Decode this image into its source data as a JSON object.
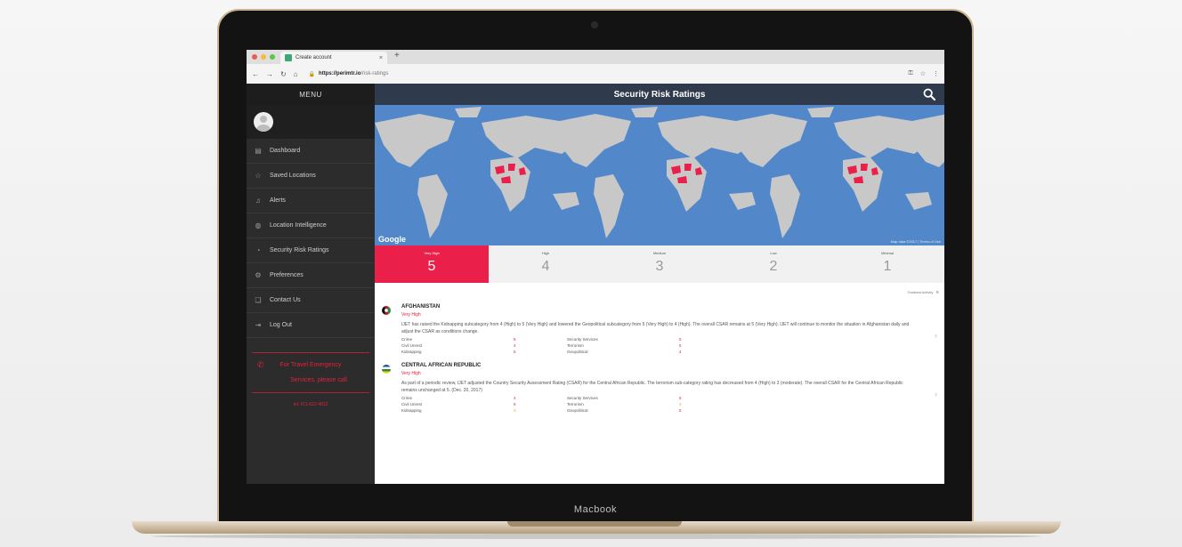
{
  "browser": {
    "tab_title": "Create account",
    "url_host": "https://perimtr.io",
    "url_path": "/risk-ratings",
    "new_tab": "+",
    "close": "×"
  },
  "device": {
    "label": "Macbook"
  },
  "sidebar": {
    "menu_title": "MENU",
    "items": [
      {
        "label": "Dashboard",
        "icon": "grid-icon"
      },
      {
        "label": "Saved Locations",
        "icon": "star-icon"
      },
      {
        "label": "Alerts",
        "icon": "bell-icon"
      },
      {
        "label": "Location Intelligence",
        "icon": "globe-icon"
      },
      {
        "label": "Security Risk Ratings",
        "icon": "gauge-icon"
      },
      {
        "label": "Preferences",
        "icon": "gear-icon"
      },
      {
        "label": "Contact Us",
        "icon": "chat-icon"
      },
      {
        "label": "Log Out",
        "icon": "logout-icon"
      }
    ],
    "emergency": {
      "line1": "For Travel Emergency",
      "line2": "Services, please call",
      "phone": "tel: 011-622-4812"
    }
  },
  "main": {
    "title": "Security Risk Ratings",
    "map": {
      "google": "Google",
      "note": "Map data ©2017 | Terms of Use"
    },
    "ratings": [
      {
        "label": "Very High",
        "value": "5",
        "active": true
      },
      {
        "label": "High",
        "value": "4",
        "active": false
      },
      {
        "label": "Medium",
        "value": "3",
        "active": false
      },
      {
        "label": "Low",
        "value": "2",
        "active": false
      },
      {
        "label": "Minimal",
        "value": "1",
        "active": false
      }
    ],
    "sort_label": "Greatest Activity",
    "countries": [
      {
        "name": "AFGHANISTAN",
        "level": "Very High",
        "description": "IJET has raised the Kidnapping subcategory from 4 (High) to 5 (Very High) and lowered the Geopolitical subcategory from 5 (Very High) to 4 (High). The overall CSAR remains at 5 (Very High). IJET will continue to monitor the situation in Afghanistan daily and adjust the CSAR as conditions change.",
        "subcategories": [
          {
            "left": "Crime",
            "left_val": "5",
            "right": "Security Services",
            "right_val": "5"
          },
          {
            "left": "Civil Unrest",
            "left_val": "4",
            "right": "Terrorism",
            "right_val": "5"
          },
          {
            "left": "Kidnapping",
            "left_val": "5",
            "right": "Geopolitical",
            "right_val": "4"
          }
        ]
      },
      {
        "name": "CENTRAL AFRICAN REPUBLIC",
        "level": "Very High",
        "description": "As part of a periodic review, IJET adjusted the Country Security Assessment Rating (CSAR) for the Central African Republic. The terrorism sub-category rating has decreased from 4 (High) to 3 (moderate). The overall CSAR for the Central African Republic remains unchanged at 5. (Dec. 20, 2017)",
        "subcategories": [
          {
            "left": "Crime",
            "left_val": "4",
            "right": "Security Services",
            "right_val": "5"
          },
          {
            "left": "Civil Unrest",
            "left_val": "5",
            "right": "Terrorism",
            "right_val": "3"
          },
          {
            "left": "Kidnapping",
            "left_val": "3",
            "right": "Geopolitical",
            "right_val": "5"
          }
        ]
      }
    ]
  },
  "colors": {
    "accent": "#ea1f4a",
    "header": "#2f3b4c",
    "sidebar": "#2c2c2c",
    "ocean": "#5288c9",
    "land": "#c8c8c8",
    "amber": "#f2a71b"
  }
}
